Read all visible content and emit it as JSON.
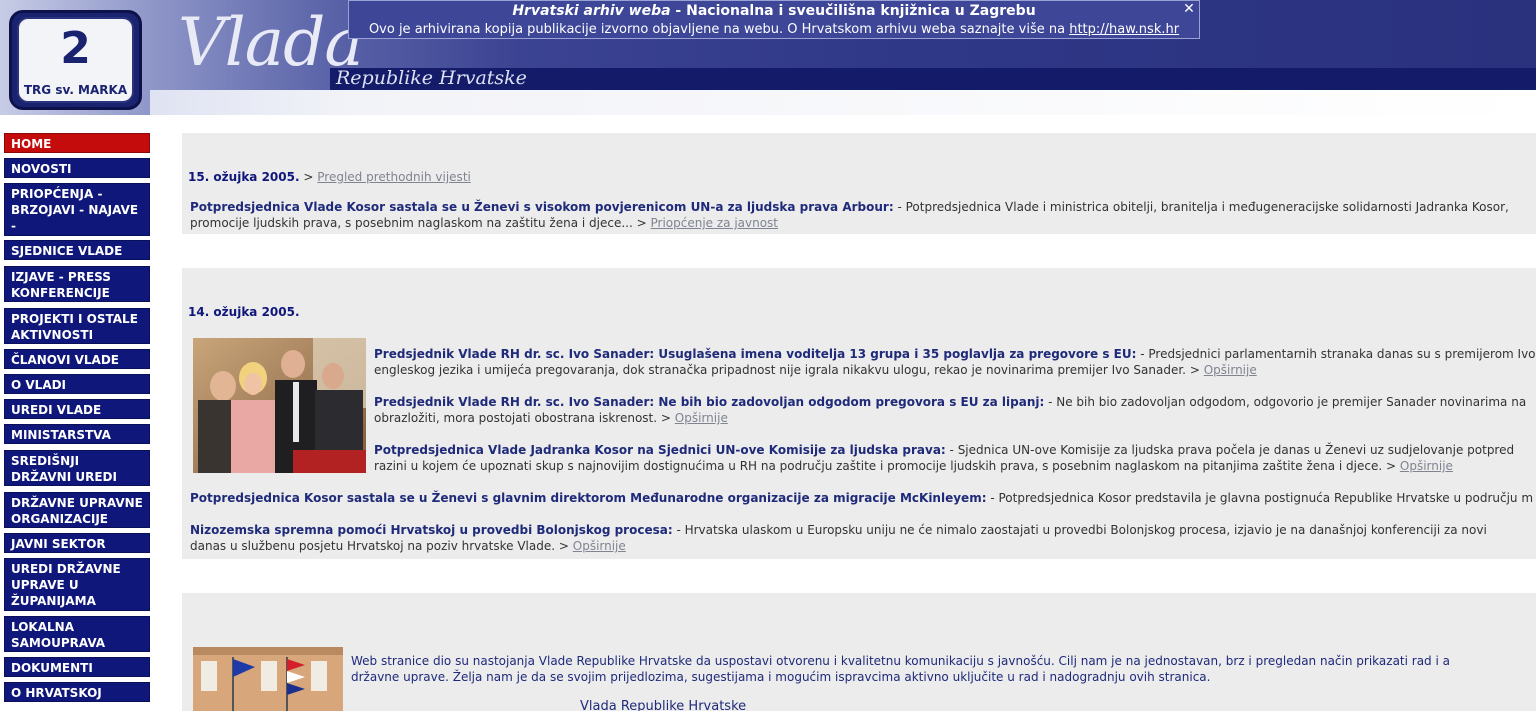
{
  "archive": {
    "title": "Hrvatski arhiv weba",
    "title_suffix": "- Nacionalna i sveučilišna knjižnica u Zagrebu",
    "note": "Ovo je arhivirana kopija publikacije izvorno objavljene na webu. O Hrvatskom arhivu weba saznajte više na",
    "link": "http://haw.nsk.hr",
    "close_label": "✕"
  },
  "header": {
    "logo_number": "2",
    "logo_street": "TRG sv. MARKA",
    "brand": "Vlada",
    "brand_sub": "Republike Hrvatske"
  },
  "nav": [
    "HOME",
    "NOVOSTI",
    "PRIOPĆENJA - BRZOJAVI - NAJAVE -",
    "SJEDNICE VLADE",
    "IZJAVE - PRESS KONFERENCIJE",
    "PROJEKTI I OSTALE AKTIVNOSTI",
    "ČLANOVI VLADE",
    "O VLADI",
    "UREDI VLADE",
    "MINISTARSTVA",
    "SREDIŠNJI DRŽAVNI UREDI",
    "DRŽAVNE UPRAVNE ORGANIZACIJE",
    "JAVNI SEKTOR",
    "UREDI DRŽAVNE UPRAVE U ŽUPANIJAMA",
    "LOKALNA SAMOUPRAVA",
    "DOKUMENTI",
    "O HRVATSKOJ"
  ],
  "nav_active": "HOME",
  "section1": {
    "date": "15. ožujka 2005.",
    "arrow": ">",
    "prev_link": "Pregled prethodnih vijesti",
    "item": {
      "headline": "Potpredsjednica Vlade Kosor sastala se u Ženevi s visokom povjerenicom UN-a za ljudska prava Arbour:",
      "line1": "- Potpredsjednica Vlade i ministrica obitelji, branitelja i međugeneracijske solidarnosti Jadranka Kosor,",
      "line2": "promocije ljudskih prava, s posebnim naglaskom na zaštitu žena i djece...",
      "arrow": ">",
      "link": "Priopćenje za javnost"
    }
  },
  "section2": {
    "date": "14. ožujka 2005.",
    "items": [
      {
        "headline": "Predsjednik Vlade RH dr. sc. Ivo Sanader: Usuglašena imena voditelja 13 grupa i 35 poglavlja za pregovore s EU:",
        "line1": "- Predsjednici parlamentarnih stranaka danas su s premijerom Ivo",
        "line2": "engleskog jezika i umijeća pregovaranja, dok stranačka pripadnost nije igrala nikakvu ulogu, rekao je novinarima premijer Ivo Sanader.",
        "arrow": ">",
        "link": "Opširnije"
      },
      {
        "headline": "Predsjednik Vlade RH dr. sc. Ivo Sanader: Ne bih bio zadovoljan odgodom pregovora s EU za lipanj:",
        "line1": "- Ne bih bio zadovoljan odgodom, odgovorio je premijer Sanader novinarima na",
        "line2": "obrazložiti, mora postojati obostrana iskrenost.",
        "arrow": ">",
        "link": "Opširnije"
      },
      {
        "headline": "Potpredsjednica Vlade Jadranka Kosor na Sjednici UN-ove Komisije za ljudska prava:",
        "line1": "- Sjednica UN-ove Komisije za ljudska prava počela je danas u Ženevi uz sudjelovanje potpred",
        "line2": "razini u kojem će upoznati skup s najnovijim dostignućima u RH na području zaštite i promocije ljudskih prava, s posebnim naglaskom na pitanjima zaštite žena i djece.",
        "arrow": ">",
        "link": "Opširnije"
      },
      {
        "headline": "Potpredsjednica Kosor sastala se u Ženevi s glavnim direktorom Međunarodne organizacije za migracije McKinleyem:",
        "line1": "- Potpredsjednica Kosor predstavila je glavna postignuća Republike Hrvatske u području m",
        "line2": "",
        "arrow": "",
        "link": ""
      },
      {
        "headline": "Nizozemska spremna pomoći Hrvatskoj u provedbi Bolonjskog procesa:",
        "line1": "- Hrvatska ulaskom u Europsku uniju ne će nimalo zaostajati u provedbi Bolonjskog procesa, izjavio je na današnjoj konferenciji za novi",
        "line2": "danas u službenu posjetu Hrvatskoj na poziv hrvatske Vlade.",
        "arrow": ">",
        "link": "Opširnije"
      }
    ]
  },
  "section3": {
    "line1": "Web stranice dio su nastojanja Vlade Republike Hrvatske da  uspostavi otvorenu i kvalitetnu komunikaciju s javnošću. Cilj nam je na jednostavan, brz i pregledan način prikazati rad i a",
    "line2": "državne uprave. Želja nam je da se svojim prijedlozima, sugestijama i mogućim ispravcima aktivno uključite u rad i nadogradnju ovih stranica.",
    "signature": "Vlada Republike Hrvatske"
  },
  "colors": {
    "nav_bg": "#0f177a",
    "nav_active_bg": "#c40c0c",
    "headline": "#1f2a7a",
    "panel_bg": "#ececec",
    "link_gray": "#7f8490"
  }
}
